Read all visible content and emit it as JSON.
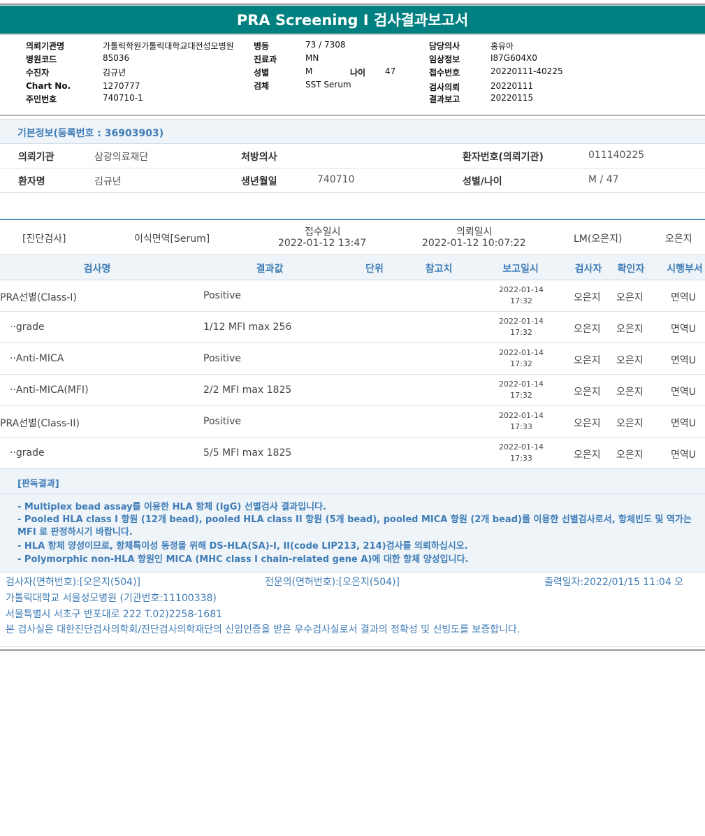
{
  "report": {
    "title": "PRA Screening I 검사결과보고서"
  },
  "header": {
    "left": [
      {
        "label": "의뢰기관명",
        "value": "가톨릭학원가톨릭대학교대전성모병원"
      },
      {
        "label": "병원코드",
        "value": "85036"
      },
      {
        "label": "수진자",
        "value": "김규년"
      },
      {
        "label": "Chart No.",
        "value": "1270777"
      },
      {
        "label": "주민번호",
        "value": "740710-1"
      }
    ],
    "middle": [
      {
        "label": "병동",
        "value": "73 / 7308"
      },
      {
        "label": "진료과",
        "value": "MN"
      },
      {
        "label": "성별",
        "value": "M"
      },
      {
        "label": "검체",
        "value": "SST Serum"
      }
    ],
    "age_label": "나이",
    "age_value": "47",
    "right": [
      {
        "label": "담당의사",
        "value": "홍유아"
      },
      {
        "label": "임상정보",
        "value": "I87G604X0"
      },
      {
        "label": "접수번호",
        "value": "20220111-40225"
      },
      {
        "label": "검사의뢰",
        "value": "20220111"
      },
      {
        "label": "결과보고",
        "value": "20220115"
      }
    ]
  },
  "basic_info": {
    "title": "기본정보(등록번호 : 36903903)",
    "row1": {
      "inst_label": "의뢰기관",
      "inst_value": "삼광의료재단",
      "doctor_label": "처방의사",
      "doctor_value": "",
      "patno_label": "환자번호(의뢰기관)",
      "patno_value": "011140225"
    },
    "row2": {
      "name_label": "환자명",
      "name_value": "김규년",
      "birth_label": "생년월일",
      "birth_value": "740710",
      "sexage_label": "성별/나이",
      "sexage_value": "M / 47"
    }
  },
  "request": {
    "category": "[진단검사]",
    "test": "이식면역[Serum]",
    "received_label": "접수일시",
    "received_value": "2022-01-12  13:47",
    "requested_label": "의뢰일시",
    "requested_value": "2022-01-12  10:07:22",
    "lab": "LM(오은지)",
    "person": "오은지"
  },
  "table": {
    "headers": {
      "test": "검사명",
      "result": "결과값",
      "unit": "단위",
      "ref": "참고치",
      "date": "보고일시",
      "tester": "검사자",
      "confirmer": "확인자",
      "dept": "시행부서"
    },
    "rows": [
      {
        "name": "PRA선별(Class-I)",
        "result": "Positive",
        "date": "2022-01-14",
        "time": "17:32",
        "tester": "오은지",
        "confirmer": "오은지",
        "dept": "면역U"
      },
      {
        "name": "··grade",
        "result": "1/12 MFI max 256",
        "date": "2022-01-14",
        "time": "17:32",
        "tester": "오은지",
        "confirmer": "오은지",
        "dept": "면역U"
      },
      {
        "name": "··Anti-MICA",
        "result": "Positive",
        "date": "2022-01-14",
        "time": "17:32",
        "tester": "오은지",
        "confirmer": "오은지",
        "dept": "면역U"
      },
      {
        "name": "··Anti-MICA(MFI)",
        "result": "2/2 MFI max 1825",
        "date": "2022-01-14",
        "time": "17:32",
        "tester": "오은지",
        "confirmer": "오은지",
        "dept": "면역U"
      },
      {
        "name": "PRA선별(Class-II)",
        "result": "Positive",
        "date": "2022-01-14",
        "time": "17:33",
        "tester": "오은지",
        "confirmer": "오은지",
        "dept": "면역U"
      },
      {
        "name": "··grade",
        "result": "5/5 MFI max 1825",
        "date": "2022-01-14",
        "time": "17:33",
        "tester": "오은지",
        "confirmer": "오은지",
        "dept": "면역U"
      }
    ]
  },
  "interpretation": {
    "title": "[판독결과]",
    "lines": [
      "- Multiplex bead assay를 이용한 HLA 항체 (IgG) 선별검사 결과입니다.",
      "- Pooled HLA class I 항원 (12개 bead), pooled HLA class II 항원 (5개 bead), pooled MICA 항원 (2개 bead)를 이용한 선별검사로서, 항체빈도 및 역가는 MFI 로 판정하시기 바랍니다.",
      "- HLA 항체 양성이므로, 항체특이성 동정을 위해 DS-HLA(SA)-I, II(code LIP213, 214)검사를 의뢰하십시오.",
      "- Polymorphic non-HLA 항원인 MICA (MHC class I chain-related gene A)에 대한 항체 양성입니다."
    ]
  },
  "footer": {
    "tester": "검사자(면허번호):[오은지(504)]",
    "specialist": "전문의(면허번호):[오은지(504)]",
    "printed": "출력일자:2022/01/15 11:04 오",
    "hospital": "가톨릭대학교 서울성모병원 (기관번호:11100338)",
    "address": "서울특별시 서초구 반포대로 222 T.02)2258-1681",
    "certification": "본 검사실은 대한진단검사의학회/진단검사의학재단의 신임인증을 받은 우수검사실로서 결과의 정확성 및 신빙도를 보증합니다."
  }
}
